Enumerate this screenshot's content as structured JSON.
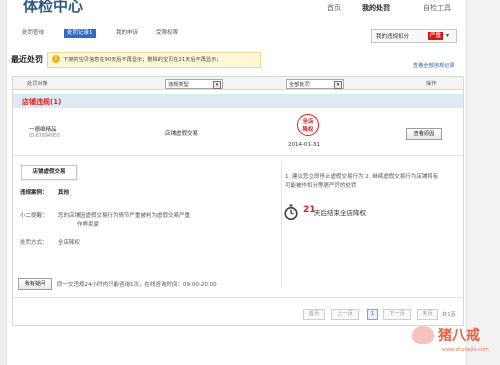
{
  "header": {
    "brand": "体检中心",
    "nav": [
      "首页",
      "我的处罚",
      "自检工具"
    ]
  },
  "subnav": {
    "tabs": [
      "处罚查询",
      "处罚记录1",
      "我的申诉",
      "受限权限"
    ],
    "score_label": "我的违规扣分",
    "score_badge": "严重"
  },
  "page": {
    "title": "最近处罚",
    "tip": "下架的宝贝信息在90天后不再显示；删除的宝贝在21天后不再显示；",
    "view_all": "查看全部违规记录"
  },
  "table": {
    "headers": {
      "object": "处罚对象",
      "type_select": "违规类型",
      "status_select": "全部处罚",
      "action": "操作"
    },
    "section_title": "店铺违规(1)",
    "row": {
      "shop_name": "一德维精品",
      "shop_id": "ID:67694955",
      "violation": "店铺虚假交易",
      "stamp_line1": "全店",
      "stamp_line2": "降权",
      "date": "2014-01-31",
      "action_button": "查看原因"
    },
    "detail": {
      "tag": "店铺虚假交易",
      "case_label": "违规案例：",
      "case_value": "其他",
      "hint_label": "小二提醒：",
      "hint_line1": "您的店铺因虚假交易行为情节严重被判为虚假交易严重",
      "hint_line2": "作弊卖家",
      "method_label": "处罚方式：",
      "method_value": "全店降权",
      "question_button": "我有疑问",
      "question_note": "同一交违规24小时内只能咨询1次，在线咨询时间：09:00-20:00",
      "advice_line1": "1. 建议您立即停止虚假交易行为 2. 继续虚假交易行为店铺将有",
      "advice_line2": "可能被作扣分等更严厉的处罚",
      "countdown_number": "21",
      "countdown_text": "天后结束全店降权"
    }
  },
  "pager": {
    "first": "首页",
    "prev": "上一页",
    "current": "1",
    "next": "下一页",
    "last": "末页",
    "total": "共1页"
  },
  "watermark": {
    "text": "猪八戒",
    "url": "www.zhubajie.com"
  }
}
